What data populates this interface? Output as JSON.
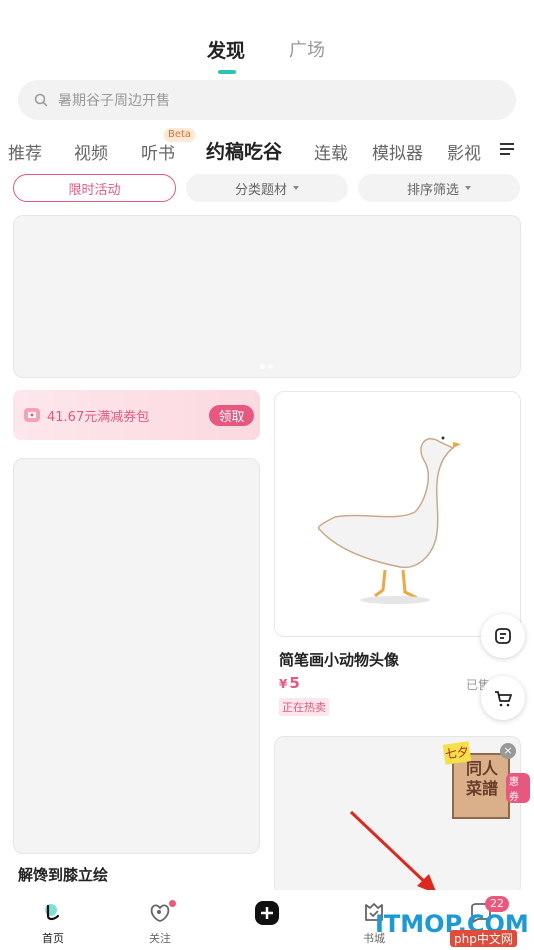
{
  "top_tabs": {
    "active": "发现",
    "inactive": "广场"
  },
  "search": {
    "placeholder": "暑期谷子周边开售"
  },
  "categories": [
    "推荐",
    "视频",
    "听书",
    "约稿吃谷",
    "连载",
    "模拟器",
    "影视"
  ],
  "beta_badge": "Beta",
  "filters": {
    "limited": "限时活动",
    "category": "分类题材",
    "sort": "排序筛选"
  },
  "coupon": {
    "text": "41.67元满减券包",
    "button": "领取"
  },
  "cards": {
    "left_title": "解馋到膝立绘",
    "right_title": "简笔画小动物头像",
    "right_currency": "¥",
    "right_price": "5",
    "right_sold": "已售",
    "right_badge": "正在热卖"
  },
  "promo": {
    "tag": "七夕",
    "title": "同人菜譜",
    "label": "惠券"
  },
  "bottom_nav": {
    "home": "首页",
    "follow": "关注",
    "bookcity": "书城",
    "message_count": "22"
  },
  "watermark": {
    "text": "ITMOP.COM",
    "php": "php中文网"
  },
  "colors": {
    "accent": "#2cc3b9",
    "pink": "#e8577f",
    "arrow": "#e0271d"
  },
  "icons": [
    "search-icon",
    "menu-icon",
    "chat-icon",
    "cart-icon",
    "home-icon",
    "follow-icon",
    "add-icon",
    "bookcity-icon",
    "message-icon",
    "close-icon",
    "coupon-icon"
  ]
}
